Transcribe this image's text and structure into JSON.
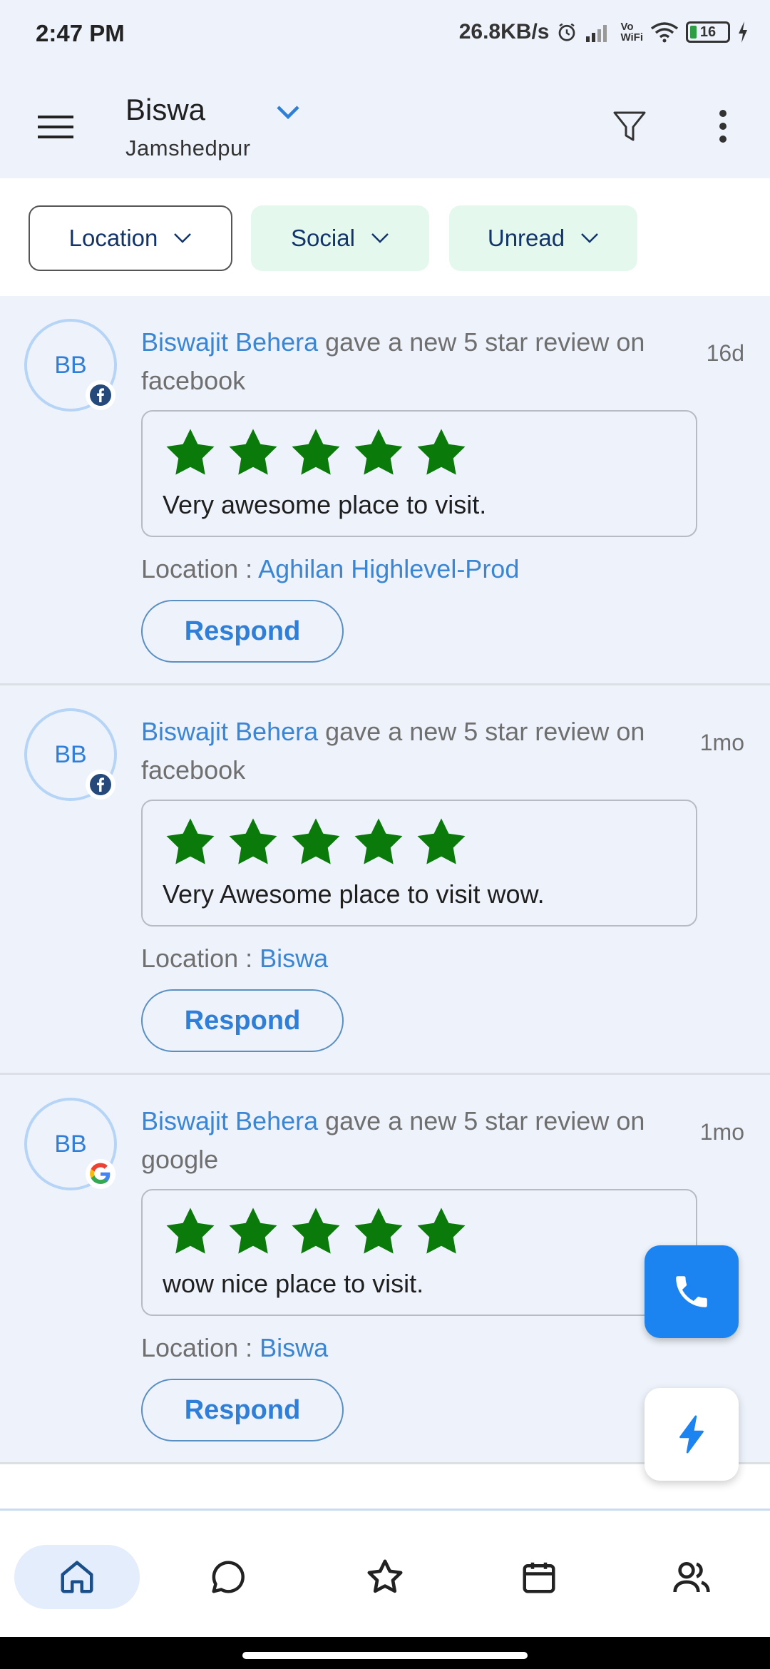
{
  "status": {
    "time": "2:47 PM",
    "net_speed": "26.8KB/s",
    "vowifi_top": "Vo",
    "vowifi_bottom": "WiFi",
    "battery": "16"
  },
  "header": {
    "account_name": "Biswa",
    "account_location": "Jamshedpur"
  },
  "filters": [
    {
      "label": "Location"
    },
    {
      "label": "Social"
    },
    {
      "label": "Unread"
    }
  ],
  "reviews": [
    {
      "initials": "BB",
      "source": "facebook",
      "reviewer": "Biswajit Behera",
      "action": " gave a new 5 star review on facebook",
      "ago": "16d",
      "rating": 5,
      "text": "Very awesome place to visit.",
      "location_label": "Location : ",
      "location": "Aghilan Highlevel-Prod",
      "respond_label": "Respond"
    },
    {
      "initials": "BB",
      "source": "facebook",
      "reviewer": "Biswajit Behera",
      "action": " gave a new 5 star review on facebook",
      "ago": "1mo",
      "rating": 5,
      "text": "Very Awesome place to visit wow.",
      "location_label": "Location : ",
      "location": "Biswa",
      "respond_label": "Respond"
    },
    {
      "initials": "BB",
      "source": "google",
      "reviewer": "Biswajit Behera",
      "action": " gave a new 5 star review on google",
      "ago": "1mo",
      "rating": 5,
      "text": "wow nice place to visit.",
      "location_label": "Location : ",
      "location": "Biswa",
      "respond_label": "Respond"
    }
  ],
  "colors": {
    "star": "#0a7a0a",
    "accent": "#1b84f0",
    "link": "#3a86d4"
  },
  "icons": {
    "nav": [
      "home-icon",
      "chat-icon",
      "star-icon",
      "calendar-icon",
      "contacts-icon"
    ],
    "fabs": [
      "phone-icon",
      "bolt-icon"
    ]
  }
}
